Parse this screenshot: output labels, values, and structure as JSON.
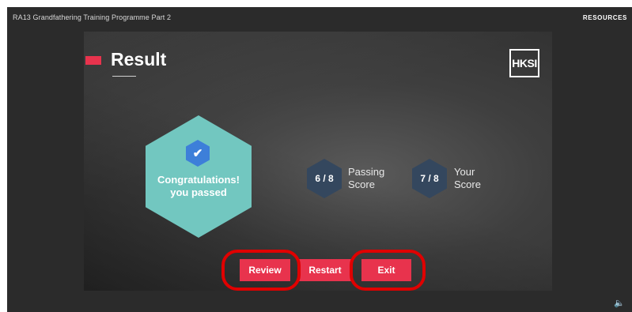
{
  "header": {
    "title": "RA13 Grandfathering Training Programme Part 2",
    "resources_label": "RESOURCES"
  },
  "slide": {
    "title": "Result",
    "logo_text": "HKSI",
    "result_badge": {
      "icon": "check-icon",
      "message_line1": "Congratulations!",
      "message_line2": "you passed"
    },
    "passing_score": {
      "value": "6 / 8",
      "label_line1": "Passing",
      "label_line2": "Score"
    },
    "your_score": {
      "value": "7 / 8",
      "label_line1": "Your",
      "label_line2": "Score"
    },
    "buttons": {
      "review": "Review",
      "restart": "Restart",
      "exit": "Exit"
    }
  },
  "player": {
    "volume_icon": "speaker-icon"
  },
  "colors": {
    "accent_red": "#e8334d",
    "badge_teal": "#72c7c0",
    "check_blue": "#3d7fd9",
    "score_hex": "#34475e",
    "highlight_ring": "#e00000"
  }
}
